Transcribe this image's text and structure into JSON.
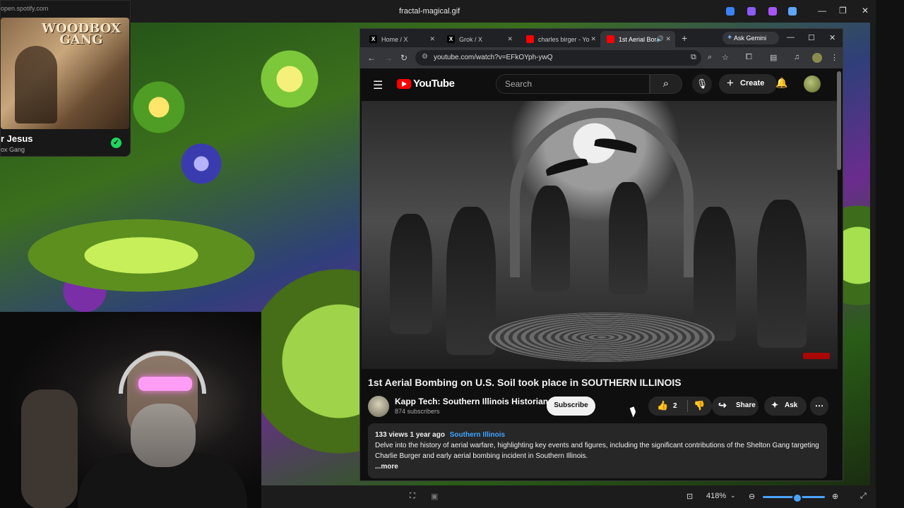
{
  "viewer": {
    "title": "fractal-magical.gif",
    "zoom": "418%"
  },
  "spotify": {
    "url": "open.spotify.com",
    "album_logo_line1": "WOODBOX",
    "album_logo_line2": "GANG",
    "song_title": "r Jesus",
    "artist": "ox Gang"
  },
  "browser": {
    "tabs": [
      {
        "label": "Home / X",
        "icon": "x-logo-icon"
      },
      {
        "label": "Grok / X",
        "icon": "x-logo-icon"
      },
      {
        "label": "charles birger - Yo",
        "icon": "youtube-icon"
      },
      {
        "label": "1st Aerial Bor",
        "icon": "youtube-icon"
      }
    ],
    "gemini_label": "Ask Gemini",
    "url": "youtube.com/watch?v=EFkOYph-ywQ"
  },
  "youtube": {
    "logo_text": "YouTube",
    "search_placeholder": "Search",
    "create_label": "Create",
    "video_title": "1st Aerial Bombing on U.S. Soil took place in SOUTHERN ILLINOIS",
    "channel_name": "Kapp Tech: Southern Illinois Historian",
    "subscribers": "874 subscribers",
    "subscribe_label": "Subscribe",
    "likes": "2",
    "share_label": "Share",
    "ask_label": "Ask",
    "views_date": "133 views  1 year ago",
    "hashtag": "Southern Illinois",
    "description": "Delve into the history of aerial warfare, highlighting key events and figures, including the significant contributions of the Shelton Gang targeting Charlie Burger and early aerial bombing incident in Southern Illinois.",
    "more_label": "...more"
  },
  "colors": {
    "accent_red": "#ff0000",
    "link_blue": "#3ea6ff",
    "spotify_green": "#1ed760"
  }
}
